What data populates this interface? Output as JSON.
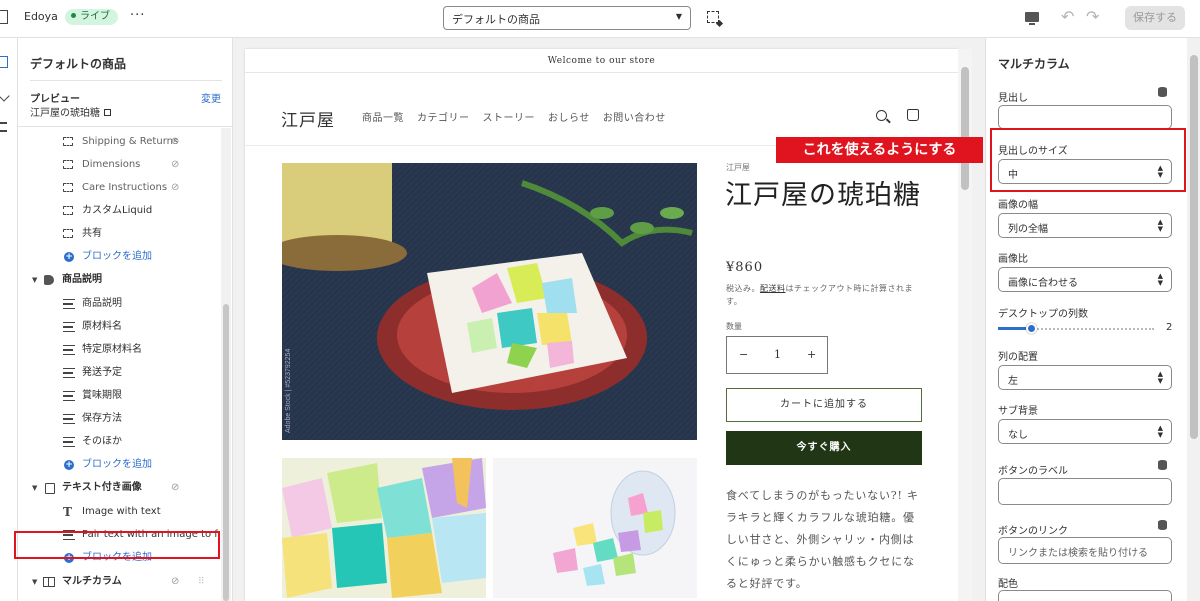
{
  "topbar": {
    "store_name": "Edoya",
    "live_badge": "ライブ",
    "more": "···",
    "template_select": "デフォルトの商品",
    "save_label": "保存する"
  },
  "left_panel": {
    "title": "デフォルトの商品",
    "preview_label": "プレビュー",
    "preview_change": "変更",
    "preview_value": "江戸屋の琥珀糖",
    "items": [
      {
        "label": "Shipping & Returns",
        "icon": "bracket-icon",
        "hidden": true
      },
      {
        "label": "Dimensions",
        "icon": "bracket-icon",
        "hidden": true
      },
      {
        "label": "Care Instructions",
        "icon": "bracket-icon",
        "hidden": true
      },
      {
        "label": "カスタムLiquid",
        "icon": "bracket-icon",
        "hidden": false
      },
      {
        "label": "共有",
        "icon": "bracket-icon",
        "hidden": false
      },
      {
        "label": "ブロックを追加",
        "icon": "add-icon",
        "hidden": false
      },
      {
        "label": "商品説明",
        "icon": "tag-icon",
        "hidden": false
      },
      {
        "label": "商品説明",
        "icon": "text-lines-icon",
        "hidden": false
      },
      {
        "label": "原材料名",
        "icon": "text-lines-icon",
        "hidden": false
      },
      {
        "label": "特定原材料名",
        "icon": "text-lines-icon",
        "hidden": false
      },
      {
        "label": "発送予定",
        "icon": "text-lines-icon",
        "hidden": false
      },
      {
        "label": "賞味期限",
        "icon": "text-lines-icon",
        "hidden": false
      },
      {
        "label": "保存方法",
        "icon": "text-lines-icon",
        "hidden": false
      },
      {
        "label": "そのほか",
        "icon": "text-lines-icon",
        "hidden": false
      },
      {
        "label": "ブロックを追加",
        "icon": "add-icon",
        "hidden": false
      },
      {
        "label": "テキスト付き画像",
        "icon": "image-text-icon",
        "hidden": true
      },
      {
        "label": "Image with text",
        "icon": "text-T-icon",
        "hidden": false
      },
      {
        "label": "Pair text with an image to f...",
        "icon": "text-lines-icon",
        "hidden": false
      },
      {
        "label": "ブロックを追加",
        "icon": "add-icon",
        "hidden": false
      },
      {
        "label": "マルチカラム",
        "icon": "columns-icon",
        "hidden": true
      }
    ]
  },
  "store": {
    "announcement": "Welcome to our store",
    "logo": "江戸屋",
    "nav": [
      "商品一覧",
      "カテゴリー",
      "ストーリー",
      "おしらせ",
      "お問い合わせ"
    ],
    "vendor": "江戸屋",
    "product_title": "江戸屋の琥珀糖",
    "price": "¥860",
    "tax_note_prefix": "税込み。",
    "tax_note_link": "配送料",
    "tax_note_suffix": "はチェックアウト時に計算されます。",
    "qty_label": "数量",
    "qty_minus": "−",
    "qty_value": "1",
    "qty_plus": "+",
    "add_to_cart": "カートに追加する",
    "buy_now": "今すぐ購入",
    "description": "食べてしまうのがもったいない?! キラキラと輝くカラフルな琥珀糖。優しい甘さと、外側シャリッ・内側はくにゅっと柔らかい触感もクセになると好評です。"
  },
  "right_panel": {
    "title": "マルチカラム",
    "heading_label": "見出し",
    "heading_value": "",
    "heading_size_label": "見出しのサイズ",
    "heading_size_value": "中",
    "image_width_label": "画像の幅",
    "image_width_value": "列の全幅",
    "image_ratio_label": "画像比",
    "image_ratio_value": "画像に合わせる",
    "desktop_columns_label": "デスクトップの列数",
    "desktop_columns_value": "2",
    "column_align_label": "列の配置",
    "column_align_value": "左",
    "sub_bg_label": "サブ背景",
    "sub_bg_value": "なし",
    "button_label_label": "ボタンのラベル",
    "button_label_value": "",
    "button_link_label": "ボタンのリンク",
    "button_link_placeholder": "リンクまたは検索を貼り付ける",
    "color_scheme_label": "配色"
  },
  "callout": "これを使えるようにする",
  "colors": {
    "accent_blue": "#2c6ecb",
    "highlight_red": "#e0141e",
    "buy_button": "#213614",
    "live_badge_bg": "#d3f5df"
  }
}
